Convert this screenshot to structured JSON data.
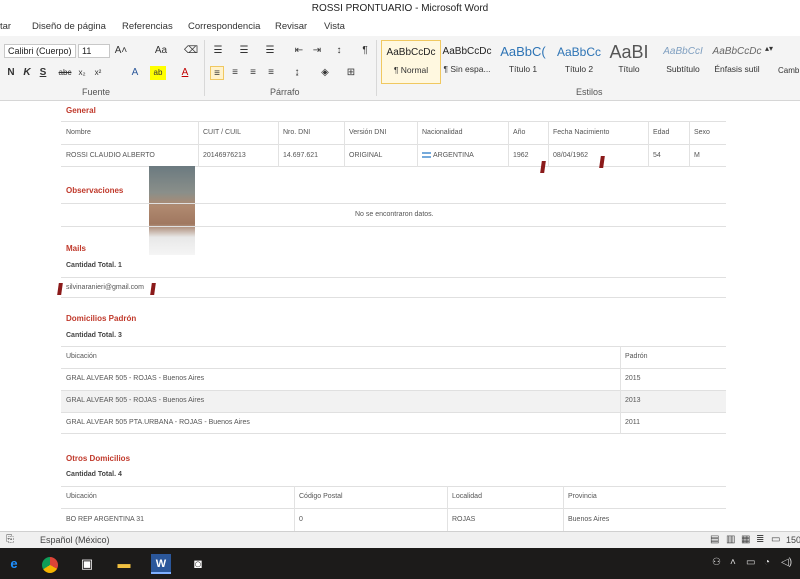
{
  "window": {
    "title": "ROSSI PRONTUARIO  -  Microsoft Word"
  },
  "tabs": [
    "tar",
    "Diseño de página",
    "Referencias",
    "Correspondencia",
    "Revisar",
    "Vista"
  ],
  "ribbon": {
    "font_name": "Calibri (Cuerpo)",
    "font_size": "11",
    "groups": {
      "fuente": "Fuente",
      "parrafo": "Párrafo",
      "estilos": "Estilos"
    },
    "styles": [
      {
        "preview": "AaBbCcDc",
        "name": "¶ Normal"
      },
      {
        "preview": "AaBbCcDc",
        "name": "¶ Sin espa..."
      },
      {
        "preview": "AaBbC(",
        "name": "Título 1"
      },
      {
        "preview": "AaBbCc",
        "name": "Título 2"
      },
      {
        "preview": "AaBI",
        "name": "Título"
      },
      {
        "preview": "AaBbCcI",
        "name": "Subtítulo"
      },
      {
        "preview": "AaBbCcDc",
        "name": "Énfasis sutil"
      }
    ],
    "change_styles": "Camb estilo"
  },
  "doc": {
    "general": {
      "title": "General",
      "headers": [
        "Nombre",
        "CUIT / CUIL",
        "Nro. DNI",
        "Versión DNI",
        "Nacionalidad",
        "Año",
        "Fecha Nacimiento",
        "Edad",
        "Sexo"
      ],
      "row": [
        "ROSSI CLAUDIO ALBERTO",
        "20146976213",
        "14.697.621",
        "ORIGINAL",
        "ARGENTINA",
        "1962",
        "08/04/1962",
        "54",
        "M"
      ]
    },
    "observaciones": {
      "title": "Observaciones",
      "empty": "No se encontraron datos."
    },
    "mails": {
      "title": "Mails",
      "count": "Cantidad Total. 1",
      "items": [
        "silvinaranieri@gmail.com"
      ]
    },
    "domicilios_padron": {
      "title": "Domicilios Padrón",
      "count": "Cantidad Total. 3",
      "headers": [
        "Ubicación",
        "Padrón"
      ],
      "rows": [
        [
          "GRAL ALVEAR 505 - ROJAS - Buenos Aires",
          "2015"
        ],
        [
          "GRAL ALVEAR 505 - ROJAS - Buenos Aires",
          "2013"
        ],
        [
          "GRAL ALVEAR 505 PTA.URBANA - ROJAS - Buenos Aires",
          "2011"
        ]
      ]
    },
    "otros_domicilios": {
      "title": "Otros Domicilios",
      "count": "Cantidad Total. 4",
      "headers": [
        "Ubicación",
        "Código Postal",
        "Localidad",
        "Provincia"
      ],
      "rows": [
        [
          "BO REP ARGENTINA 31",
          "0",
          "ROJAS",
          "Buenos Aires"
        ]
      ]
    }
  },
  "status": {
    "language": "Español (México)",
    "zoom": "150"
  },
  "colors": {
    "section_title": "#c0392b",
    "accent": "#2b579a"
  }
}
